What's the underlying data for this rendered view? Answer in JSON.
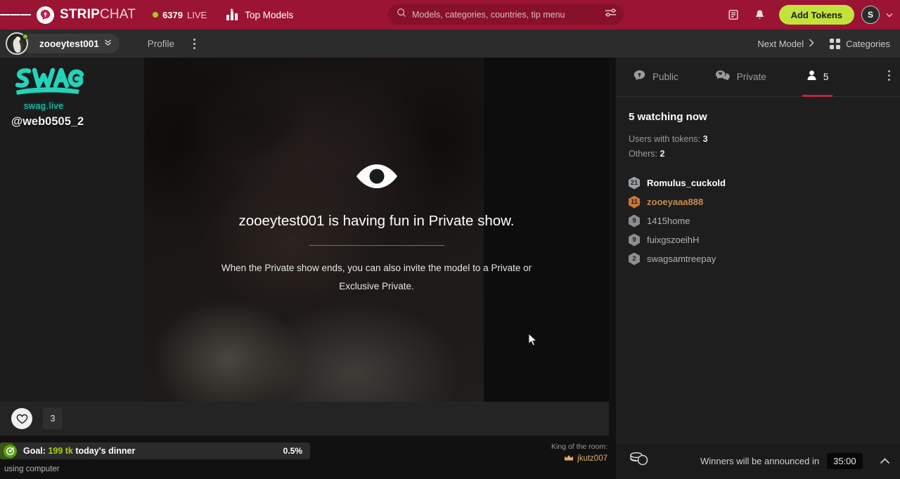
{
  "header": {
    "menu_icon": "hamburger-icon",
    "brand_bold": "STRIP",
    "brand_light": "CHAT",
    "live_count": "6379",
    "live_label": "LIVE",
    "top_models": "Top Models",
    "search_placeholder": "Models, categories, countries, tip menu",
    "search_value": "",
    "add_tokens": "Add Tokens",
    "avatar_letter": "S",
    "accent_red": "#9c1433",
    "tokens_green": "#c2e33c"
  },
  "subbar": {
    "model_name": "zooeytest001",
    "profile": "Profile",
    "next_model": "Next Model",
    "categories": "Categories"
  },
  "left": {
    "logo_text": "SWAG",
    "logo_sub": "swag.live",
    "handle": "@web0505_2",
    "logo_color": "#25d3bb"
  },
  "stage": {
    "icon": "eye-icon",
    "title": "zooeytest001 is having fun in Private show.",
    "subtitle": "When the Private show ends, you can also invite the model to a Private or Exclusive Private.",
    "like_count": "3"
  },
  "goal": {
    "label_prefix": "Goal:",
    "amount": "199 tk",
    "description": "today's dinner",
    "percent": "0.5%",
    "fill_percent": 0.5,
    "king_label": "King of the room:",
    "king_name": "jkutz007",
    "status_text": "using computer"
  },
  "chat": {
    "tabs": [
      {
        "label": "Public",
        "icon": "chat-bubble-icon",
        "active": false
      },
      {
        "label": "Private",
        "icon": "private-chat-icon",
        "active": false
      },
      {
        "label": "5",
        "icon": "user-icon",
        "active": true
      }
    ],
    "watching_title": "5 watching now",
    "stats": [
      {
        "label": "Users with tokens:",
        "value": "3"
      },
      {
        "label": "Others:",
        "value": "2"
      }
    ],
    "users": [
      {
        "badge": "21",
        "name": "Romulus_cuckold",
        "badge_color": "#9aa0a6",
        "name_color": "#ffffff"
      },
      {
        "badge": "11",
        "name": "zooeyaaa888",
        "badge_color": "#c9773a",
        "name_color": "#c98a52"
      },
      {
        "badge": "9",
        "name": "1415home",
        "badge_color": "#8d8d8d",
        "name_color": "#b4b4b4"
      },
      {
        "badge": "9",
        "name": "fuixgszoeihH",
        "badge_color": "#8d8d8d",
        "name_color": "#b4b4b4"
      },
      {
        "badge": "2",
        "name": "swagsamtreepay",
        "badge_color": "#8d8d8d",
        "name_color": "#b4b4b4"
      }
    ]
  },
  "winners": {
    "icon": "coins-icon",
    "text": "Winners will be announced in",
    "timer": "35:00"
  }
}
